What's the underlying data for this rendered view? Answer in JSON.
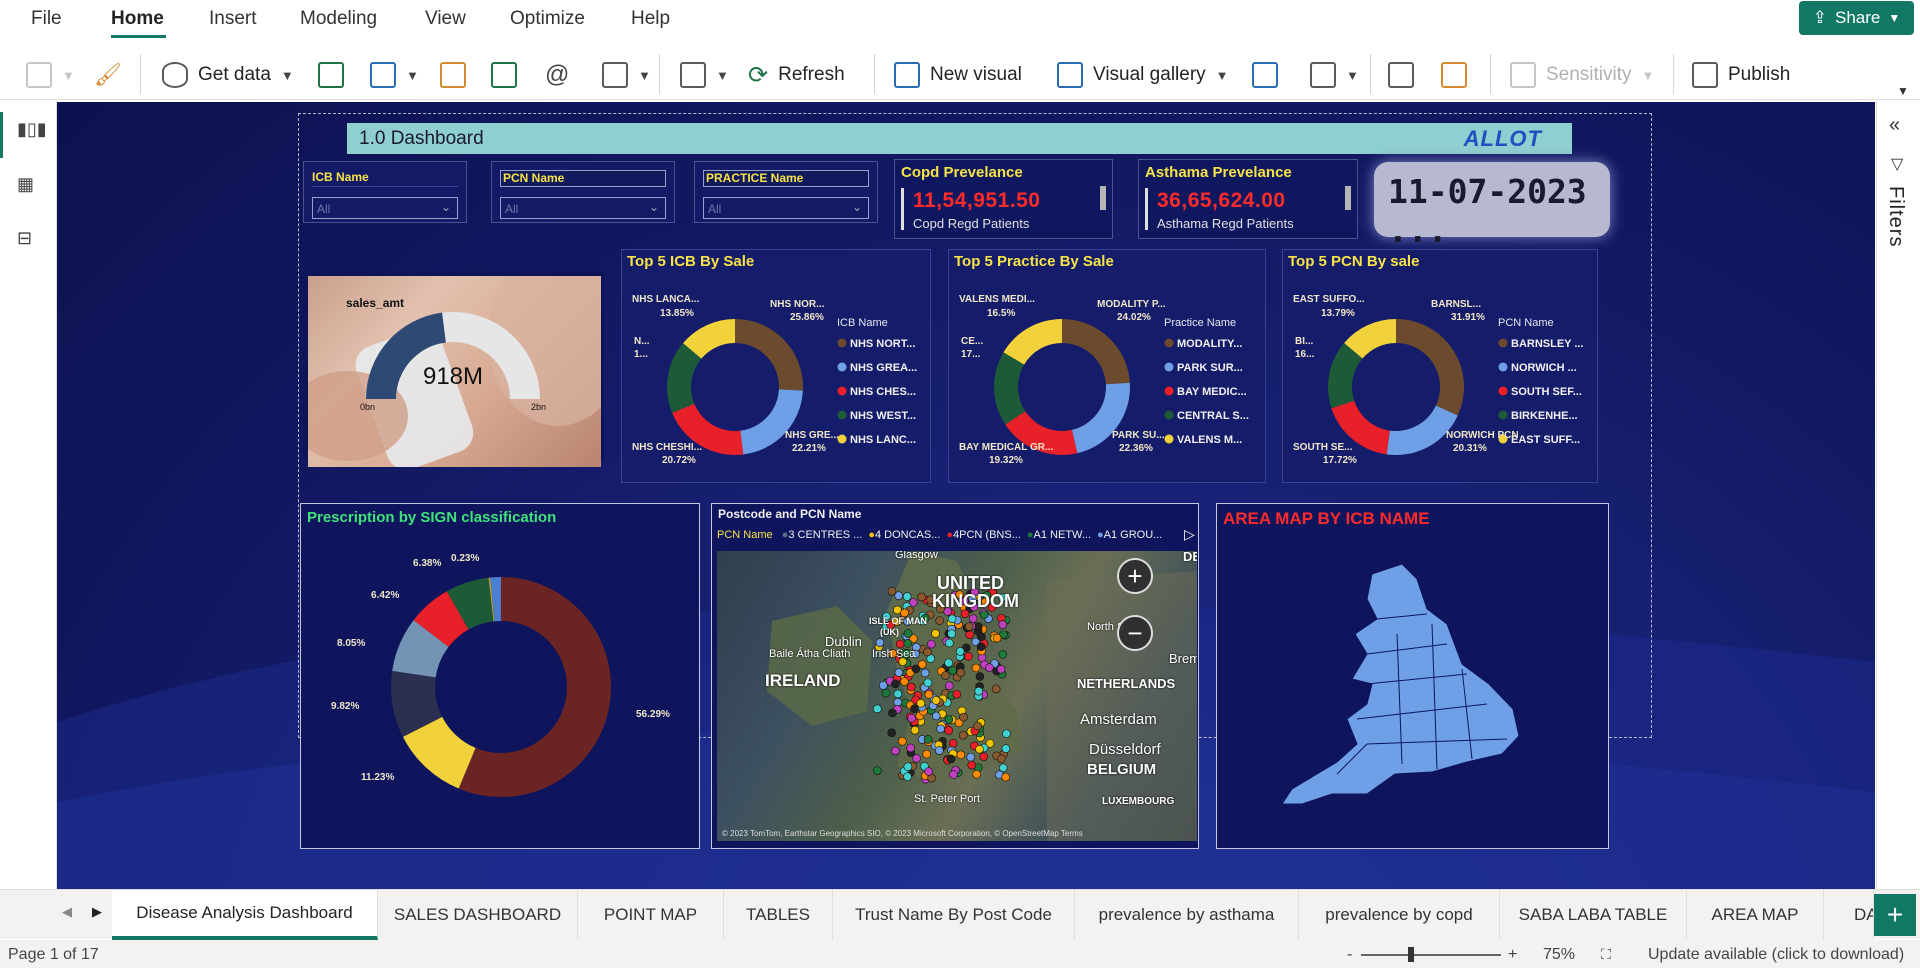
{
  "menu": {
    "items": [
      "File",
      "Home",
      "Insert",
      "Modeling",
      "View",
      "Optimize",
      "Help"
    ],
    "share": "Share"
  },
  "ribbon": {
    "get_data": "Get data",
    "refresh": "Refresh",
    "new_visual": "New visual",
    "visual_gallery": "Visual gallery",
    "sensitivity": "Sensitivity",
    "publish": "Publish"
  },
  "side": {
    "filters": "Filters"
  },
  "dashboard": {
    "title": "1.0 Dashboard",
    "logo": "ALLOT",
    "slicers": [
      {
        "label": "ICB Name",
        "value": "All"
      },
      {
        "label": "PCN Name",
        "value": "All"
      },
      {
        "label": "PRACTICE Name",
        "value": "All"
      }
    ],
    "kpis": [
      {
        "title": "Copd Prevelance",
        "value": "11,54,951.50",
        "sub": "Copd Regd Patients"
      },
      {
        "title": "Asthama Prevelance",
        "value": "36,65,624.00",
        "sub": "Asthama Regd Patients"
      }
    ],
    "date": "11-07-2023 ...",
    "gauge": {
      "label": "sales_amt",
      "value": "918M",
      "min": "0bn",
      "max": "2bn",
      "fraction": 0.46
    }
  },
  "colors": {
    "brown": "#6b4a2e",
    "lightblue": "#6f9fe6",
    "red": "#e8202a",
    "green": "#1d5a38",
    "yellow": "#f2d23a",
    "dark_red": "#6b2424",
    "slate": "#2c3050",
    "blue_grey": "#7494b6",
    "accent_green": "#117865"
  },
  "pies": [
    {
      "title": "Top 5 ICB By Sale",
      "legend_title": "ICB Name",
      "legend": [
        "NHS NORT...",
        "NHS GREA...",
        "NHS CHES...",
        "NHS WEST...",
        "NHS LANC..."
      ],
      "labels": [
        "NHS LANCA...",
        "13.85%",
        "NHS NOR...",
        "25.86%",
        "N...",
        "1...",
        "NHS GRE...",
        "22.21%",
        "NHS CHESHI...",
        "20.72%"
      ]
    },
    {
      "title": "Top 5 Practice By Sale",
      "legend_title": "Practice Name",
      "legend": [
        "MODALITY...",
        "PARK SUR...",
        "BAY MEDIC...",
        "CENTRAL S...",
        "VALENS M..."
      ],
      "labels": [
        "VALENS MEDI...",
        "16.5%",
        "MODALITY P...",
        "24.02%",
        "CE...",
        "17...",
        "PARK SU...",
        "22.36%",
        "BAY MEDICAL GR...",
        "19.32%"
      ]
    },
    {
      "title": "Top 5 PCN By sale",
      "legend_title": "PCN Name",
      "legend": [
        "BARNSLEY ...",
        "NORWICH ...",
        "SOUTH SEF...",
        "BIRKENHE...",
        "EAST SUFF..."
      ],
      "labels": [
        "EAST SUFFO...",
        "13.79%",
        "BARNSL...",
        "31.91%",
        "BI...",
        "16...",
        "NORWICH PCN",
        "20.31%",
        "SOUTH SE...",
        "17.72%"
      ]
    }
  ],
  "chart_data": [
    {
      "type": "pie",
      "title": "Top 5 ICB By Sale",
      "categories": [
        "NHS NORT...",
        "NHS GREA...",
        "NHS CHES...",
        "NHS WEST...",
        "NHS LANC..."
      ],
      "values": [
        25.86,
        22.21,
        20.72,
        17.36,
        13.85
      ]
    },
    {
      "type": "pie",
      "title": "Top 5 Practice By Sale",
      "categories": [
        "MODALITY...",
        "PARK SUR...",
        "BAY MEDIC...",
        "CENTRAL S...",
        "VALENS M..."
      ],
      "values": [
        24.02,
        22.36,
        19.32,
        17.8,
        16.5
      ]
    },
    {
      "type": "pie",
      "title": "Top 5 PCN By sale",
      "categories": [
        "BARNSLEY ...",
        "NORWICH ...",
        "SOUTH SEF...",
        "BIRKENHE...",
        "EAST SUFF..."
      ],
      "values": [
        31.91,
        20.31,
        17.72,
        16.27,
        13.79
      ]
    },
    {
      "type": "pie",
      "title": "Prescription by SIGN classification",
      "categories": [
        "",
        "",
        "",
        "",
        "",
        "",
        "",
        ""
      ],
      "values": [
        56.29,
        11.23,
        9.82,
        8.05,
        6.42,
        6.38,
        0.23,
        1.58
      ],
      "labels": [
        "56.29%",
        "11.23%",
        "9.82%",
        "8.05%",
        "6.42%",
        "6.38%",
        "0.23%"
      ]
    }
  ],
  "sign_chart": {
    "title": "Prescription by SIGN classification"
  },
  "map": {
    "title": "Postcode and PCN Name",
    "legend_title": "PCN Name",
    "legend": [
      "3 CENTRES ...",
      "4 DONCAS...",
      "4PCN (BNS...",
      "A1 NETW...",
      "A1 GROU..."
    ],
    "legend_colors": [
      "#5a6f8a",
      "#f2c300",
      "#e8202a",
      "#1d7a3a",
      "#6f9fe6"
    ],
    "place_labels": [
      "Glasgow",
      "UNITED",
      "KINGDOM",
      "Dublin",
      "Baile Átha Cliath",
      "IRELAND",
      "Irish Sea",
      "ISLE OF MAN",
      "(UK)",
      "North S",
      "NETHERLANDS",
      "Amsterdam",
      "Düsseldorf",
      "BELGIUM",
      "LUXEMBOURG",
      "St. Peter Port",
      "DE",
      "Brem"
    ],
    "attribution": "© 2023 TomTom, Earthstar Geographics SIO, © 2023 Microsoft Corporation, © OpenStreetMap  Terms"
  },
  "area_map": {
    "title": "AREA MAP BY ICB NAME"
  },
  "tabs": [
    "Disease Analysis Dashboard",
    "SALES DASHBOARD",
    "POINT MAP",
    "TABLES",
    "Trust Name By Post Code",
    "prevalence by asthama",
    "prevalence by copd",
    "SABA LABA TABLE",
    "AREA MAP",
    "DA"
  ],
  "status": {
    "page": "Page 1 of 17",
    "zoom": "75%",
    "update": "Update available (click to download)"
  }
}
